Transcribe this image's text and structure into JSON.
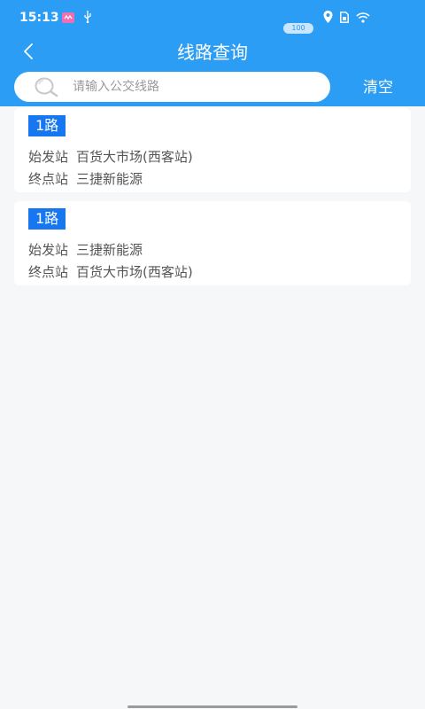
{
  "status_bar": {
    "time": "15:13",
    "battery_level": "100"
  },
  "header": {
    "title": "线路查询",
    "back_icon": "chevron-left-icon"
  },
  "search": {
    "placeholder": "请输入公交线路",
    "value": "",
    "clear_label": "清空",
    "icon": "search-icon"
  },
  "routes": [
    {
      "name": "1路",
      "start_label": "始发站",
      "start_stop": "百货大市场(西客站)",
      "end_label": "终点站",
      "end_stop": "三捷新能源"
    },
    {
      "name": "1路",
      "start_label": "始发站",
      "start_stop": "三捷新能源",
      "end_label": "终点站",
      "end_stop": "百货大市场(西客站)"
    }
  ],
  "colors": {
    "header_blue": "#2b9df5",
    "badge_blue": "#1677f0",
    "background": "#f6f7f9"
  }
}
